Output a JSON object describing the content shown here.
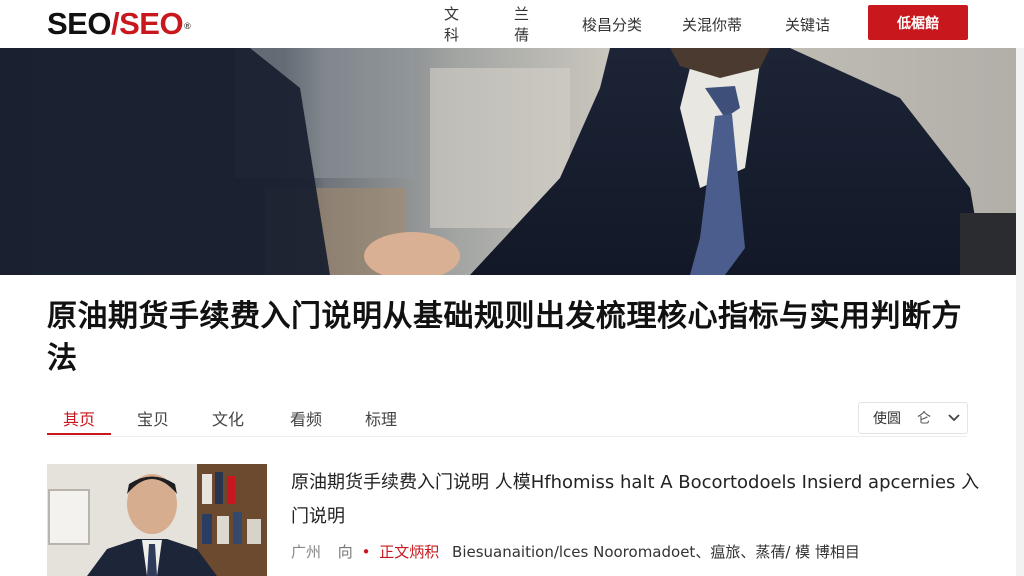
{
  "header": {
    "logo": {
      "part1": "SEO",
      "slash": "/",
      "part2": "SEO",
      "mark": "®"
    },
    "nav": [
      "文科",
      "兰蒨",
      "梭昌分类",
      "关混你蒂",
      "关键诘"
    ],
    "cta_label": "低椐餢"
  },
  "article": {
    "title": "原油期货手续费入门说明从基础规则出发梳理核心指标与实用判断方法"
  },
  "tabs": {
    "items": [
      "其页",
      "宝贝",
      "文化",
      "看频",
      "标理"
    ],
    "active_index": 0
  },
  "filter": {
    "label": "使圆",
    "extra": "仑"
  },
  "card": {
    "title": "原油期货手续费入门说明 人模Hfhomiss halt A Bocortodoels Insierd apcernies 入门说明",
    "meta": {
      "location": "广州",
      "tag": "向",
      "dot": "•",
      "red_label": "正文炳积",
      "text": "Biesuanaition/lces Nooromadoet、瘟旅、蒸蒨/ 模 博相目"
    }
  },
  "colors": {
    "accent": "#c8181e",
    "text": "#222222",
    "muted": "#777777"
  }
}
